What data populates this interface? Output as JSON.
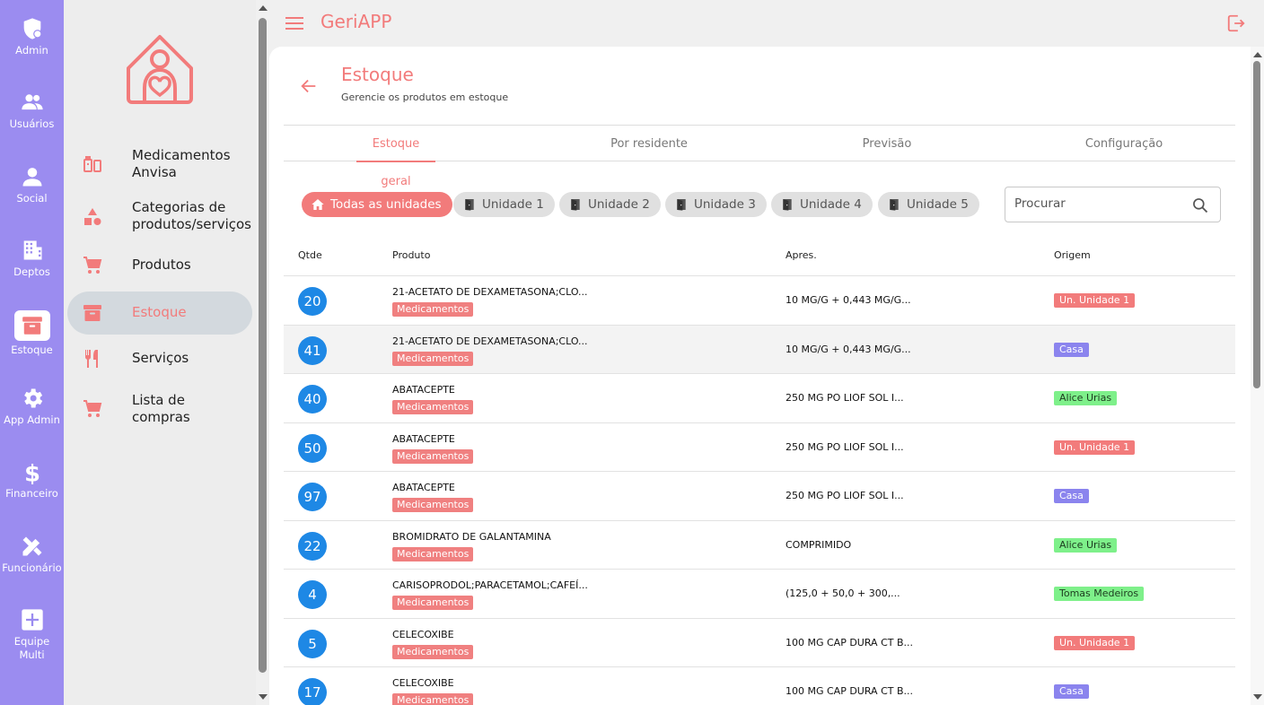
{
  "rail": [
    {
      "icon": "admin-shield-icon",
      "label": "Admin"
    },
    {
      "icon": "users-icon",
      "label": "Usuários"
    },
    {
      "icon": "person-icon",
      "label": "Social"
    },
    {
      "icon": "building-icon",
      "label": "Deptos"
    },
    {
      "icon": "archive-box-icon",
      "label": "Estoque"
    },
    {
      "icon": "gear-icon",
      "label": "App Admin"
    },
    {
      "icon": "dollar-icon",
      "label": "Financeiro"
    },
    {
      "icon": "pencil-ruler-icon",
      "label": "Funcionário"
    },
    {
      "icon": "plus-box-icon",
      "label": "Equipe\nMulti"
    }
  ],
  "menu": [
    {
      "icon": "medicine-icon",
      "label": "Medicamentos Anvisa"
    },
    {
      "icon": "shapes-icon",
      "label": "Categorias de produtos/serviços"
    },
    {
      "icon": "cart-icon",
      "label": "Produtos"
    },
    {
      "icon": "archive-icon",
      "label": "Estoque"
    },
    {
      "icon": "cutlery-icon",
      "label": "Serviços"
    },
    {
      "icon": "cart-icon",
      "label": "Lista de compras"
    }
  ],
  "header": {
    "title": "GeriAPP"
  },
  "page": {
    "title": "Estoque",
    "subtitle": "Gerencie os produtos em estoque"
  },
  "tabs": [
    "Estoque geral",
    "Por residente",
    "Previsão",
    "Configuração"
  ],
  "chips": [
    "Todas as unidades",
    "Unidade 1",
    "Unidade 2",
    "Unidade 3",
    "Unidade 4",
    "Unidade 5"
  ],
  "search": {
    "placeholder": "Procurar"
  },
  "table": {
    "headers": [
      "Qtde",
      "Produto",
      "Apres.",
      "Origem"
    ],
    "rows": [
      {
        "qty": "20",
        "product": "21-ACETATO DE DEXAMETASONA;CLO...",
        "tag": "Medicamentos",
        "apres": "10 MG/G + 0,443 MG/G...",
        "origin": "Un. Unidade 1",
        "origin_color": "#f27b7b"
      },
      {
        "qty": "41",
        "product": "21-ACETATO DE DEXAMETASONA;CLO...",
        "tag": "Medicamentos",
        "apres": "10 MG/G + 0,443 MG/G...",
        "origin": "Casa",
        "origin_color": "#8b84ee"
      },
      {
        "qty": "40",
        "product": "ABATACEPTE",
        "tag": "Medicamentos",
        "apres": "250 MG PO LIOF SOL I...",
        "origin": "Alice Urias",
        "origin_color": "#7ef08a"
      },
      {
        "qty": "50",
        "product": "ABATACEPTE",
        "tag": "Medicamentos",
        "apres": "250 MG PO LIOF SOL I...",
        "origin": "Un. Unidade 1",
        "origin_color": "#f27b7b"
      },
      {
        "qty": "97",
        "product": "ABATACEPTE",
        "tag": "Medicamentos",
        "apres": "250 MG PO LIOF SOL I...",
        "origin": "Casa",
        "origin_color": "#8b84ee"
      },
      {
        "qty": "22",
        "product": "BROMIDRATO DE GALANTAMINA",
        "tag": "Medicamentos",
        "apres": "COMPRIMIDO",
        "origin": "Alice Urias",
        "origin_color": "#7ef08a"
      },
      {
        "qty": "4",
        "product": "CARISOPRODOL;PARACETAMOL;CAFEÍ...",
        "tag": "Medicamentos",
        "apres": "(125,0 + 50,0 + 300,...",
        "origin": "Tomas Medeiros",
        "origin_color": "#7ef08a"
      },
      {
        "qty": "5",
        "product": "CELECOXIBE",
        "tag": "Medicamentos",
        "apres": "100 MG CAP DURA CT B...",
        "origin": "Un. Unidade 1",
        "origin_color": "#f27b7b"
      },
      {
        "qty": "17",
        "product": "CELECOXIBE",
        "tag": "Medicamentos",
        "apres": "100 MG CAP DURA CT B...",
        "origin": "Casa",
        "origin_color": "#8b84ee"
      }
    ]
  },
  "colors": {
    "accent": "#f27b7b",
    "rail": "#9b8cf0",
    "qty_badge": "#1e88e5"
  }
}
